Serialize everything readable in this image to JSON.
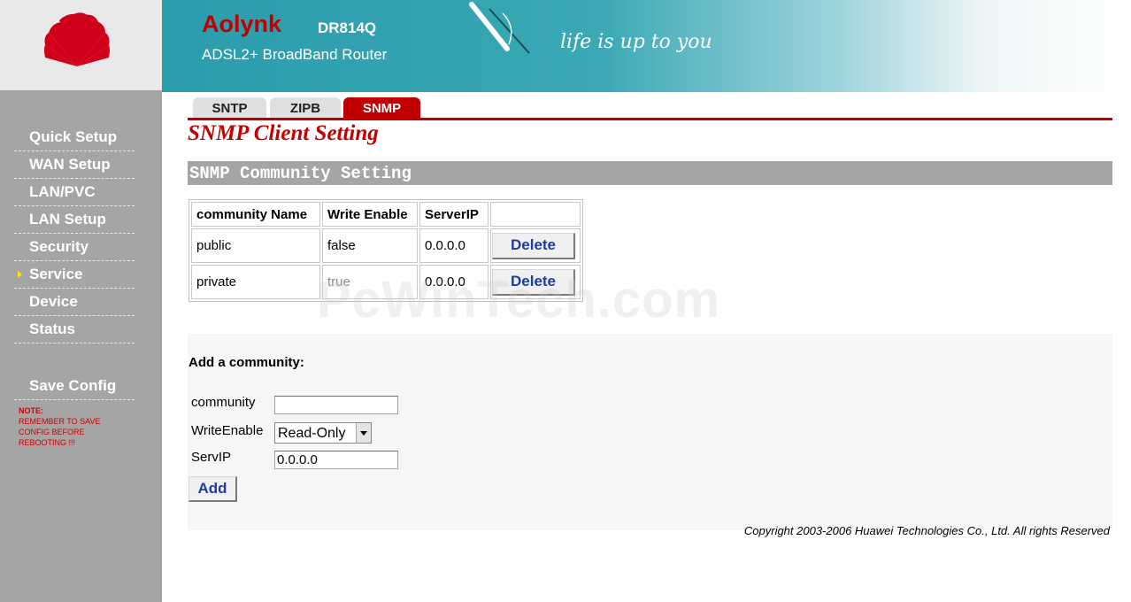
{
  "header": {
    "brand": "Aolynk",
    "model": "DR814Q",
    "subtitle": "ADSL2+ BroadBand Router",
    "slogan": "life is up to you"
  },
  "sidebar": {
    "items": [
      {
        "label": "Quick Setup",
        "active": false
      },
      {
        "label": "WAN Setup",
        "active": false
      },
      {
        "label": "LAN/PVC",
        "active": false
      },
      {
        "label": "LAN Setup",
        "active": false
      },
      {
        "label": "Security",
        "active": false
      },
      {
        "label": "Service",
        "active": true
      },
      {
        "label": "Device",
        "active": false
      },
      {
        "label": "Status",
        "active": false
      }
    ],
    "save_config": "Save Config",
    "note": {
      "title": "NOTE:",
      "lines": [
        "REMEMBER TO SAVE",
        "CONFIG BEFORE",
        "REBOOTING !!!"
      ]
    }
  },
  "tabs": [
    {
      "label": "SNTP",
      "active": false
    },
    {
      "label": "ZIPB",
      "active": false
    },
    {
      "label": "SNMP",
      "active": true
    }
  ],
  "page_title": "SNMP Client Setting",
  "section_title": "SNMP Community Setting",
  "community_table": {
    "headers": [
      "community Name",
      "Write Enable",
      "ServerIP",
      ""
    ],
    "rows": [
      {
        "name": "public",
        "write_enable": "false",
        "server_ip": "0.0.0.0",
        "action": "Delete"
      },
      {
        "name": "private",
        "write_enable": "true",
        "server_ip": "0.0.0.0",
        "action": "Delete"
      }
    ]
  },
  "add_form": {
    "heading": "Add a community:",
    "community_label": "community",
    "community_value": "",
    "write_enable_label": "WriteEnable",
    "write_enable_value": "Read-Only",
    "serv_ip_label": "ServIP",
    "serv_ip_value": "0.0.0.0",
    "add_button": "Add"
  },
  "copyright": "Copyright 2003-2006 Huawei Technologies Co., Ltd. All rights Reserved",
  "watermark": "PcWinTech.com",
  "colors": {
    "accent_red": "#c00000",
    "sidebar_gray": "#a5a5a5",
    "banner_teal": "#2a9cab",
    "button_text_blue": "#1d3ea0",
    "active_arrow": "#ffe400"
  }
}
